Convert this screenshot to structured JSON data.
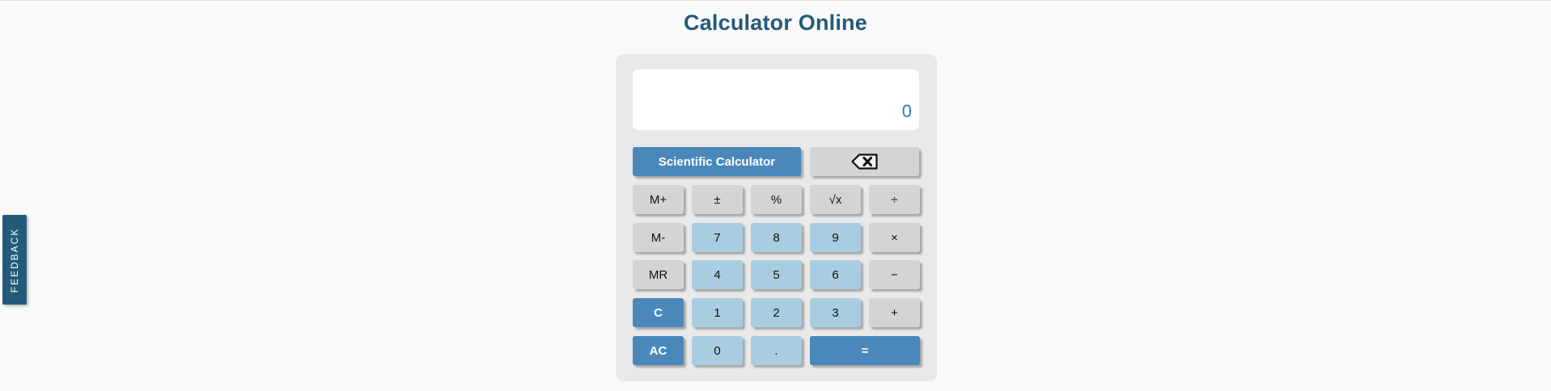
{
  "page": {
    "title": "Calculator Online"
  },
  "feedback": {
    "label": "FEEDBACK"
  },
  "calculator": {
    "display_value": "0",
    "scientific_label": "Scientific Calculator",
    "backspace_icon": "backspace-icon",
    "keys": {
      "m_plus": "M+",
      "plus_minus": "±",
      "percent": "%",
      "sqrt": "√x",
      "divide": "÷",
      "m_minus": "M-",
      "seven": "7",
      "eight": "8",
      "nine": "9",
      "multiply": "×",
      "mr": "MR",
      "four": "4",
      "five": "5",
      "six": "6",
      "subtract": "−",
      "clear": "C",
      "one": "1",
      "two": "2",
      "three": "3",
      "add": "+",
      "all_clear": "AC",
      "zero": "0",
      "decimal": ".",
      "equals": "="
    }
  },
  "colors": {
    "title": "#235a7a",
    "accent_blue": "#4a88bb",
    "digit_key": "#a9cde0",
    "function_key": "#d4d4d4",
    "display_text": "#2a7ab8",
    "feedback_tab": "#235a7a"
  }
}
